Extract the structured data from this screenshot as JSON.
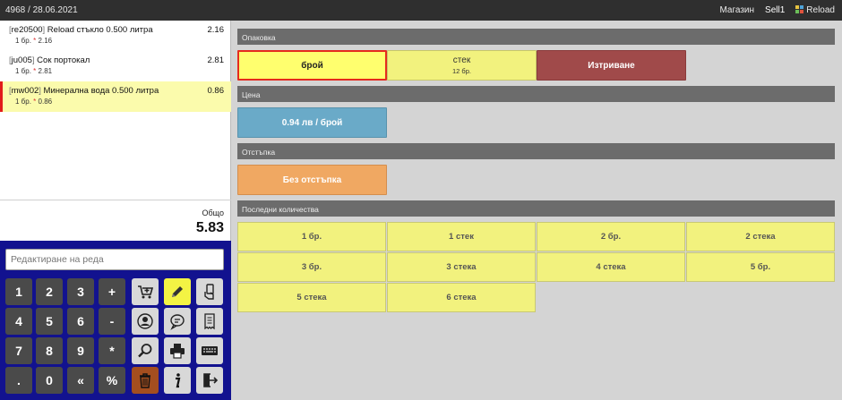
{
  "topbar": {
    "doc": "4968 / 28.06.2021",
    "store": "Магазин",
    "user": "Sell1",
    "reload": "Reload"
  },
  "order": {
    "items": [
      {
        "code": "re20500",
        "name": "Reload стъкло 0.500 литра",
        "price": "2.16",
        "qty": "1 бр.",
        "mult": "*",
        "unit_price": "2.16"
      },
      {
        "code": "ju005",
        "name": "Сок портокал",
        "price": "2.81",
        "qty": "1 бр.",
        "mult": "*",
        "unit_price": "2.81"
      },
      {
        "code": "mw002",
        "name": "Минерална вода 0.500 литра",
        "price": "0.86",
        "qty": "1 бр.",
        "mult": "*",
        "unit_price": "0.86"
      }
    ],
    "selected_index": 2,
    "total_label": "Общо",
    "total_value": "5.83"
  },
  "keypad": {
    "placeholder": "Редактиране на реда",
    "keys": [
      "1",
      "2",
      "3",
      "+",
      "4",
      "5",
      "6",
      "-",
      "7",
      "8",
      "9",
      "*",
      ".",
      "0",
      "«",
      "%"
    ],
    "icons": [
      "cart-add-icon",
      "pencil-icon",
      "hand-card-icon",
      "user-icon",
      "chat-icon",
      "receipt-icon",
      "search-icon",
      "printer-icon",
      "keyboard-icon",
      "trash-icon",
      "info-icon",
      "exit-icon"
    ]
  },
  "packaging": {
    "title": "Опаковка",
    "piece": "брой",
    "stack": "стек",
    "stack_sub": "12 бр.",
    "delete": "Изтриване"
  },
  "price": {
    "title": "Цена",
    "value": "0.94 лв / брой"
  },
  "discount": {
    "title": "Отстъпка",
    "value": "Без отстъпка"
  },
  "recent": {
    "title": "Последни количества",
    "items": [
      "1 бр.",
      "1 стек",
      "2 бр.",
      "2 стека",
      "3 бр.",
      "3 стека",
      "4 стека",
      "5 бр.",
      "5 стека",
      "6 стека"
    ]
  },
  "colors": {
    "topbar": "#2f2f2f",
    "keypad_bg": "#12128f",
    "selected_row": "#fbfbac",
    "accent_red": "#e21b1b"
  }
}
